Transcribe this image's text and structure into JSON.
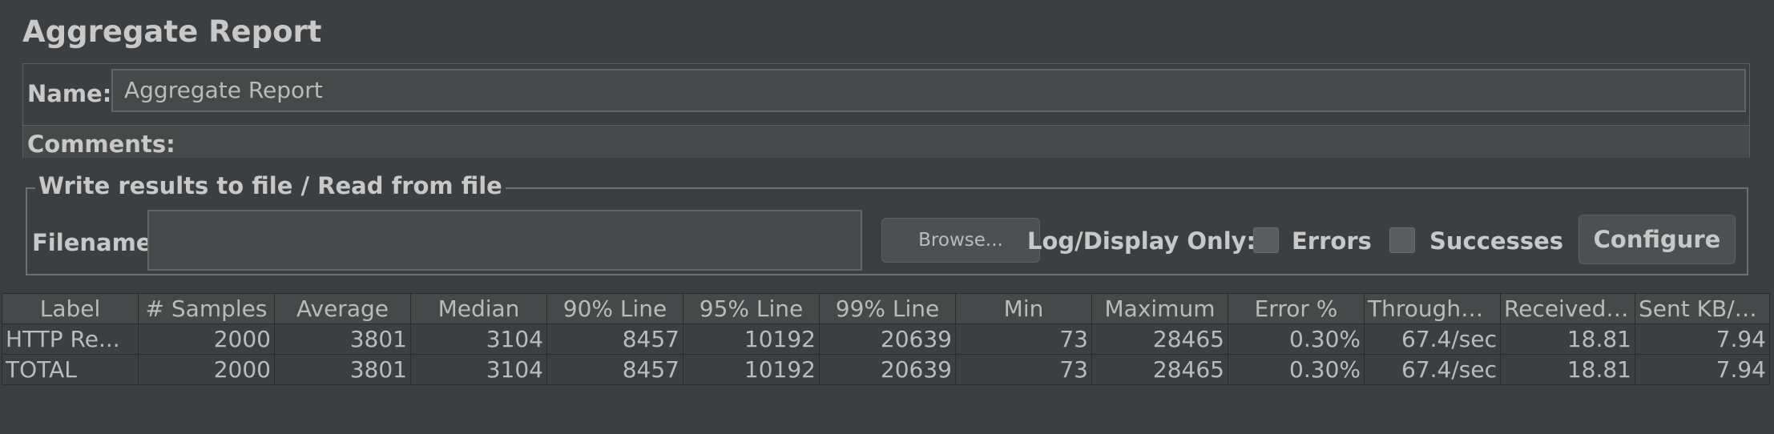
{
  "panel": {
    "title": "Aggregate Report"
  },
  "name_field": {
    "label": "Name:",
    "value": "Aggregate Report"
  },
  "comments": {
    "label": "Comments:"
  },
  "file_section": {
    "legend": "Write results to file / Read from file",
    "filename_label": "Filename",
    "filename_value": "",
    "browse_label": "Browse...",
    "log_display_label": "Log/Display Only:",
    "errors_label": "Errors",
    "errors_checked": false,
    "successes_label": "Successes",
    "successes_checked": false,
    "configure_label": "Configure"
  },
  "table": {
    "columns": [
      "Label",
      "# Samples",
      "Average",
      "Median",
      "90% Line",
      "95% Line",
      "99% Line",
      "Min",
      "Maximum",
      "Error %",
      "Throughput",
      "Received ...",
      "Sent KB/sec"
    ],
    "rows": [
      [
        "HTTP Re...",
        "2000",
        "3801",
        "3104",
        "8457",
        "10192",
        "20639",
        "73",
        "28465",
        "0.30%",
        "67.4/sec",
        "18.81",
        "7.94"
      ],
      [
        "TOTAL",
        "2000",
        "3801",
        "3104",
        "8457",
        "10192",
        "20639",
        "73",
        "28465",
        "0.30%",
        "67.4/sec",
        "18.81",
        "7.94"
      ]
    ]
  }
}
